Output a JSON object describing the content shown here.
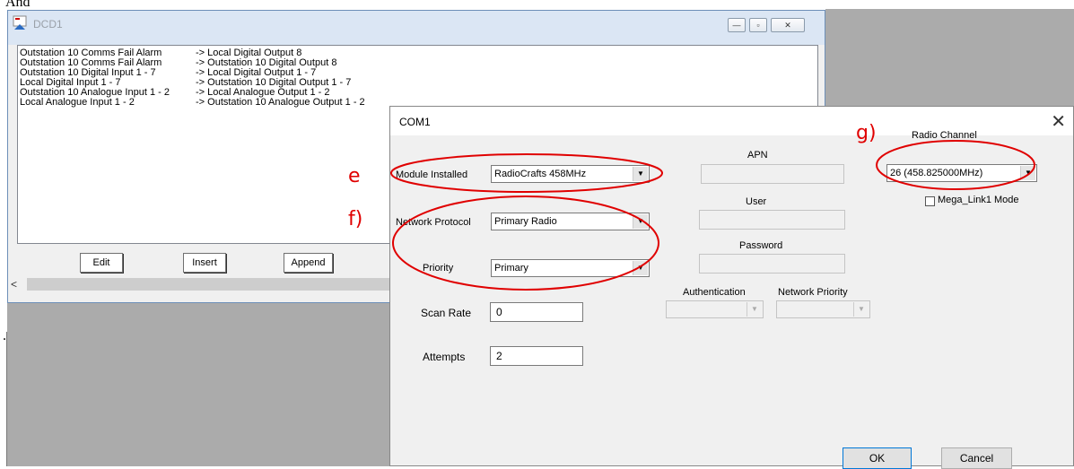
{
  "page": {
    "top_text": "And",
    "bullet": "."
  },
  "dcd1": {
    "title": "DCD1",
    "rows": [
      {
        "source": "Outstation 10 Comms Fail Alarm",
        "target": "-> Local Digital Output 8"
      },
      {
        "source": "Outstation 10 Comms Fail Alarm",
        "target": "-> Outstation 10 Digital Output 8"
      },
      {
        "source": "Outstation 10 Digital Input 1 - 7",
        "target": "-> Local Digital Output 1 - 7"
      },
      {
        "source": "Local Digital Input 1 - 7",
        "target": "-> Outstation 10 Digital Output 1 - 7"
      },
      {
        "source": "Outstation 10 Analogue Input 1 - 2",
        "target": "-> Local Analogue Output 1 - 2"
      },
      {
        "source": "Local Analogue Input 1 - 2",
        "target": "-> Outstation 10 Analogue Output 1 - 2"
      }
    ],
    "buttons": {
      "edit": "Edit",
      "insert": "Insert",
      "append": "Append"
    },
    "scroll_left": "<"
  },
  "com1": {
    "title": "COM1",
    "close": "✕",
    "module_installed": {
      "label": "Module Installed",
      "value": "RadioCrafts 458MHz"
    },
    "network_protocol": {
      "label": "Network Protocol",
      "value": "Primary Radio"
    },
    "priority": {
      "label": "Priority",
      "value": "Primary"
    },
    "scan_rate": {
      "label": "Scan Rate",
      "value": "0"
    },
    "attempts": {
      "label": "Attempts",
      "value": "2"
    },
    "apn": {
      "label": "APN",
      "value": ""
    },
    "user": {
      "label": "User",
      "value": ""
    },
    "password": {
      "label": "Password",
      "value": ""
    },
    "authentication": {
      "label": "Authentication",
      "value": ""
    },
    "network_priority": {
      "label": "Network Priority",
      "value": ""
    },
    "radio_channel": {
      "label": "Radio Channel",
      "value": "26 (458.825000MHz)"
    },
    "mega_link": {
      "label": "Mega_Link1 Mode",
      "checked": false
    },
    "ok": "OK",
    "cancel": "Cancel"
  },
  "annotations": {
    "e": "e",
    "f": "f)",
    "g": "g)",
    "color": "#e00000"
  }
}
